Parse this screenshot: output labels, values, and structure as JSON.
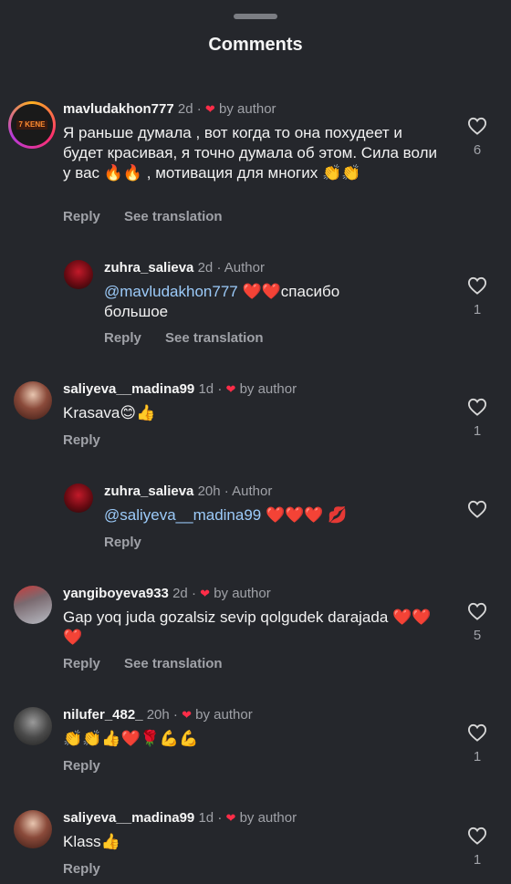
{
  "header": {
    "title": "Comments"
  },
  "comments": [
    {
      "username": "mavludakhon777",
      "time": "2d",
      "liked_label": "by author",
      "text": "Я раньше думала , вот когда то она похудеет и будет красивая, я точно думала об этом. Сила воли у вас 🔥🔥 , мотивация для многих 👏👏",
      "reply_label": "Reply",
      "translate_label": "See translation",
      "likes": "6"
    },
    {
      "username": "zuhra_salieva",
      "time": "2d",
      "tag": "Author",
      "mention": "@mavludakhon777",
      "text": " ❤️❤️спасибо большое",
      "reply_label": "Reply",
      "translate_label": "See translation",
      "likes": "1"
    },
    {
      "username": "saliyeva__madina99",
      "time": "1d",
      "liked_label": "by author",
      "text": "Krasava😊👍",
      "reply_label": "Reply",
      "likes": "1"
    },
    {
      "username": "zuhra_salieva",
      "time": "20h",
      "tag": "Author",
      "mention": "@saliyeva__madina99",
      "text": " ❤️❤️❤️ 💋",
      "reply_label": "Reply",
      "likes": ""
    },
    {
      "username": "yangiboyeva933",
      "time": "2d",
      "liked_label": "by author",
      "text": "Gap yoq juda gozalsiz sevip qolgudek darajada ❤️❤️❤️",
      "reply_label": "Reply",
      "translate_label": "See translation",
      "likes": "5"
    },
    {
      "username": "nilufer_482_",
      "time": "20h",
      "liked_label": "by author",
      "text": "👏👏👍❤️🌹💪💪",
      "reply_label": "Reply",
      "likes": "1"
    },
    {
      "username": "saliyeva__madina99",
      "time": "1d",
      "liked_label": "by author",
      "text": "Klass👍",
      "reply_label": "Reply",
      "likes": "1"
    }
  ],
  "colors": {
    "background": "#25272c",
    "heart": "#ff2d48",
    "mention": "#9ccbfa",
    "muted": "#a0a2a8"
  },
  "icons": {
    "like": "heart-outline-icon",
    "liked_by_author": "heart-filled-icon"
  }
}
